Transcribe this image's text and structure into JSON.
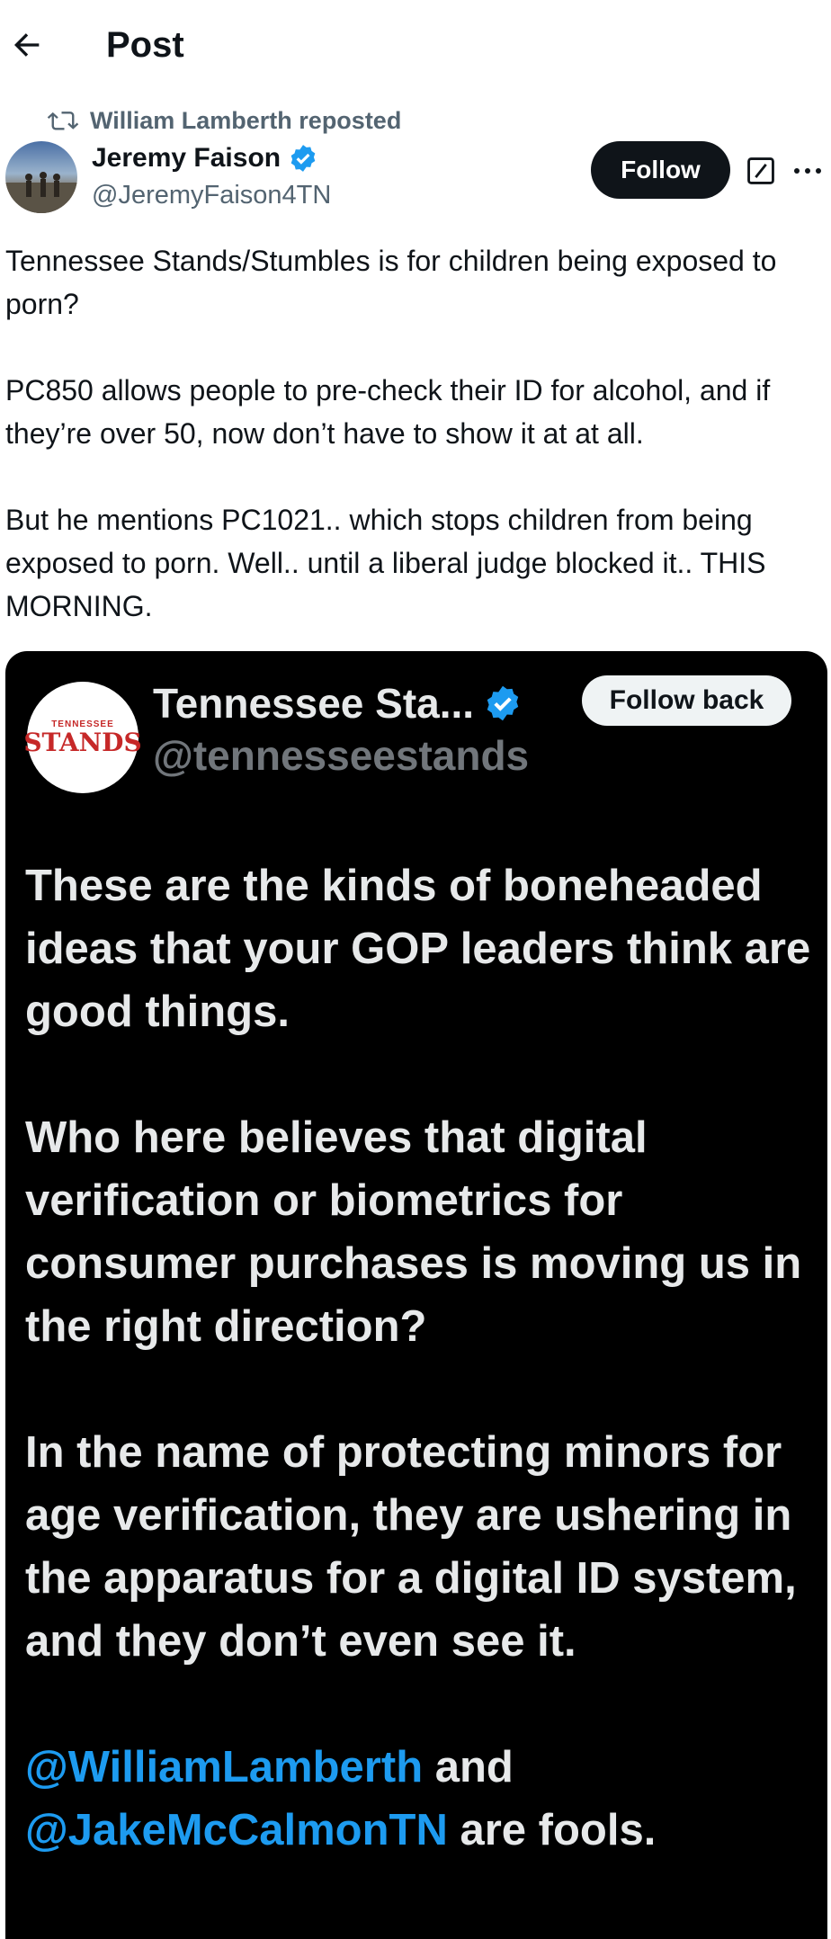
{
  "header": {
    "title": "Post"
  },
  "repost": {
    "text": "William Lamberth reposted"
  },
  "author": {
    "name": "Jeremy Faison",
    "handle": "@JeremyFaison4TN"
  },
  "actions": {
    "follow_label": "Follow"
  },
  "tweet": {
    "paragraphs": [
      "Tennessee Stands/Stumbles is for children being exposed to porn?",
      "PC850 allows people to pre-check their ID for alcohol, and if they’re over 50, now don’t have to show it at at all.",
      "But he mentions PC1021.. which stops children from being exposed to porn. Well.. until a liberal judge blocked it.. THIS MORNING."
    ]
  },
  "quote": {
    "avatar_text_small": "TENNESSEE",
    "avatar_text_big": "STANDS",
    "name": "Tennessee Sta...",
    "handle": "@tennesseestands",
    "follow_back_label": "Follow back",
    "paragraphs": [
      "These are the kinds of boneheaded ideas that your GOP leaders think are good things.",
      "Who here believes that digital verification or biometrics for consumer purchases is moving us in the right direction?",
      "In the name of protecting minors for age verification, they are ushering in the apparatus for a digital ID system, and they don’t even see it."
    ],
    "mention_1": "@WilliamLamberth",
    "mention_join": " and",
    "mention_2": "@JakeMcCalmonTN",
    "mention_tail": " are fools."
  },
  "colors": {
    "accent": "#1d9bf0",
    "verified": "#1d9bf0",
    "muted": "#536471"
  },
  "icons": [
    "back-arrow-icon",
    "repost-icon",
    "verified-icon",
    "grok-icon",
    "more-icon"
  ]
}
